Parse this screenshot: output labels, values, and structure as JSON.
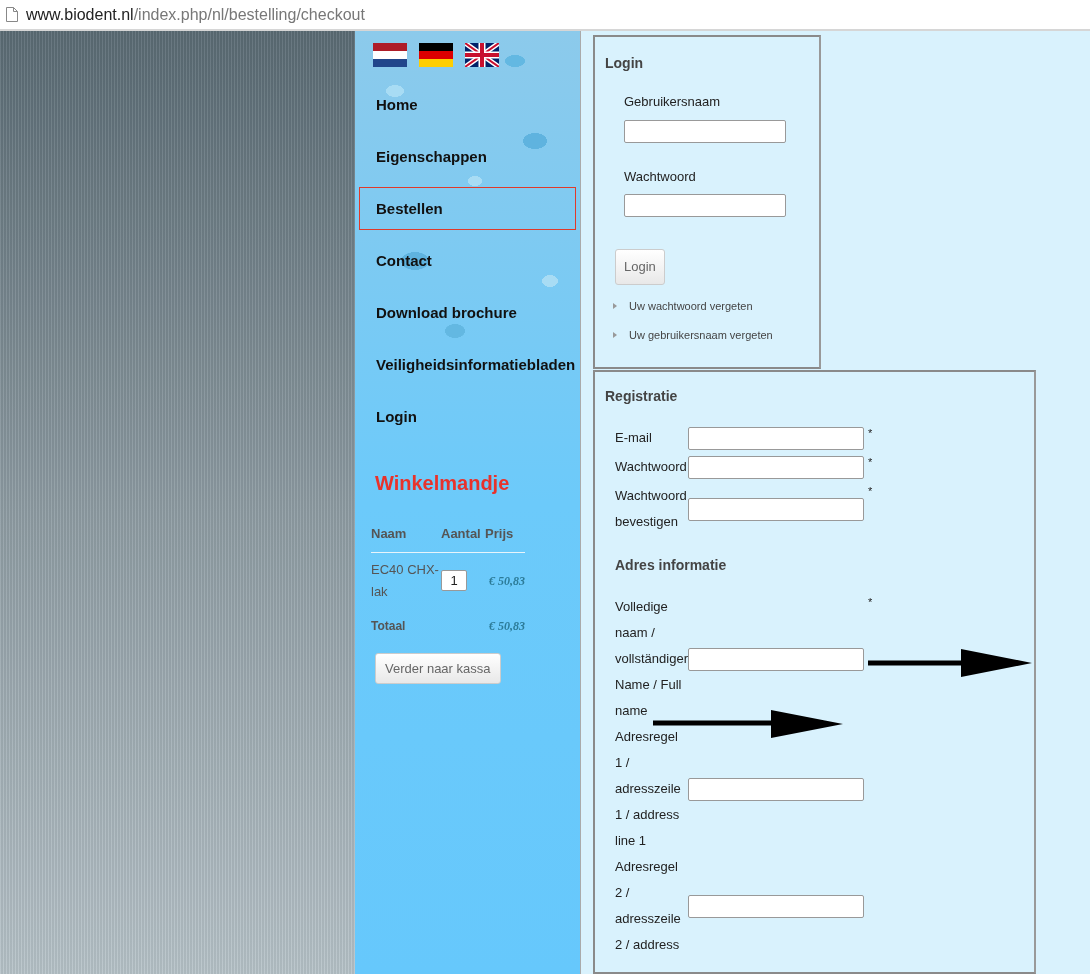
{
  "browser": {
    "url_host": "www.biodent.nl",
    "url_path": "/index.php/nl/bestelling/checkout"
  },
  "languages": [
    {
      "kind": "nl"
    },
    {
      "kind": "de"
    },
    {
      "kind": "en"
    }
  ],
  "menu": [
    {
      "label": "Home",
      "selected": false
    },
    {
      "label": "Eigenschappen",
      "selected": false
    },
    {
      "label": "Bestellen",
      "selected": true
    },
    {
      "label": "Contact",
      "selected": false
    },
    {
      "label": "Download brochure",
      "selected": false
    },
    {
      "label": "Veiligheidsinformatiebladen",
      "selected": false
    },
    {
      "label": "Login",
      "selected": false
    }
  ],
  "cart": {
    "title": "Winkelmandje",
    "columns": [
      "Naam",
      "Aantal",
      "Prijs"
    ],
    "items": [
      {
        "name": "EC40 CHX-lak",
        "quantity": "1",
        "price": "€ 50,83"
      }
    ],
    "total_label": "Totaal",
    "total": "€ 50,83",
    "button": "Verder naar kassa"
  },
  "login": {
    "title": "Login",
    "fields": [
      {
        "label": "Gebruikersnaam"
      },
      {
        "label": "Wachtwoord"
      }
    ],
    "button": "Login",
    "links": [
      "Uw wachtwoord vergeten",
      "Uw gebruikersnaam vergeten"
    ]
  },
  "registration": {
    "title": "Registratie",
    "fields": [
      {
        "label": "E-mail",
        "marker": "*"
      },
      {
        "label": "Wachtwoord",
        "marker": "*"
      },
      {
        "label": "Wachtwoord bevestigen",
        "marker": "*"
      }
    ],
    "section": "Adres informatie",
    "address_fields": [
      {
        "label": "Volledige naam / vollständiger Name / Full name",
        "marker": "*"
      },
      {
        "label": "Adresregel 1 / adresszeile 1 / address line 1"
      },
      {
        "label": "Adresregel 2 / adresszeile 2 / address"
      }
    ]
  }
}
